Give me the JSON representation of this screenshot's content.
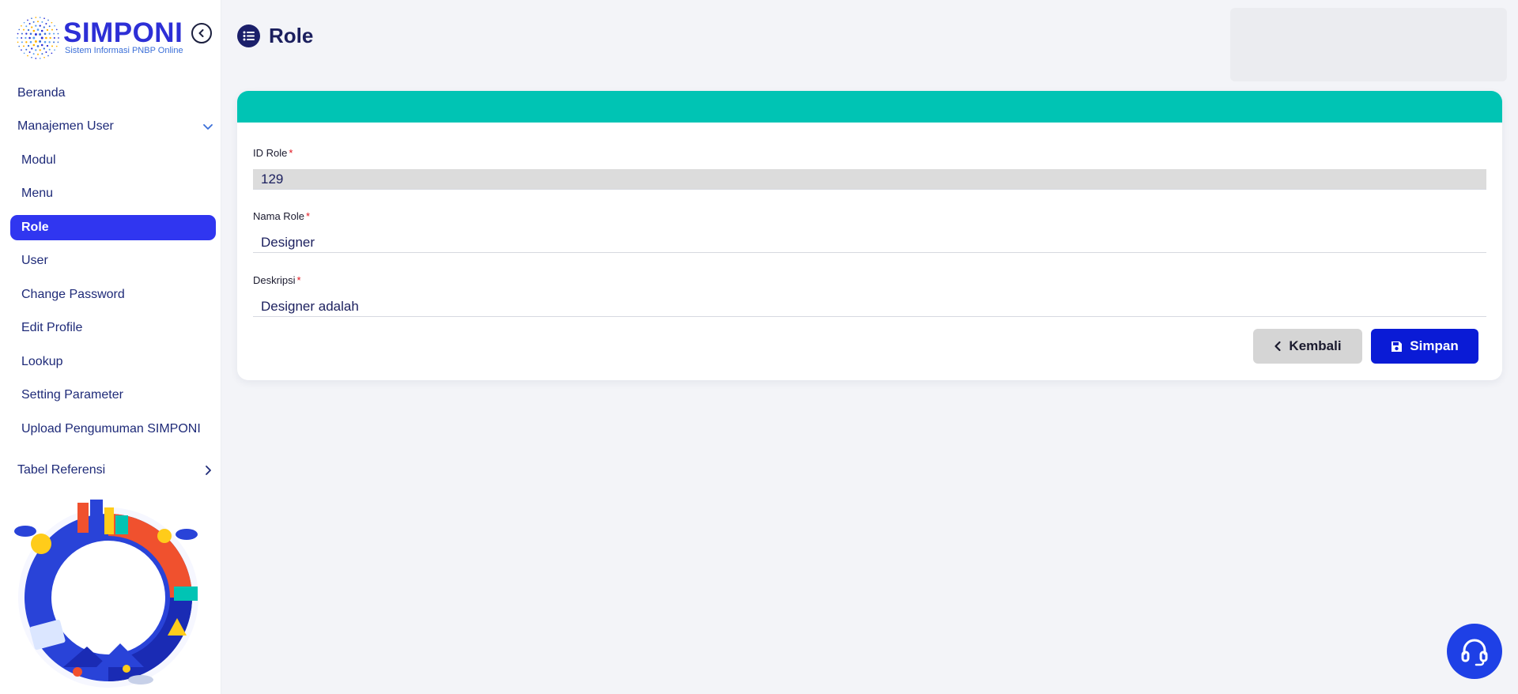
{
  "app": {
    "name": "SIMPONI",
    "subtitle": "Sistem Informasi PNBP Online"
  },
  "sidebar": {
    "items": [
      {
        "label": "Beranda"
      },
      {
        "label": "Manajemen User"
      },
      {
        "label": "Modul"
      },
      {
        "label": "Menu"
      },
      {
        "label": "Role"
      },
      {
        "label": "User"
      },
      {
        "label": "Change Password"
      },
      {
        "label": "Edit Profile"
      },
      {
        "label": "Lookup"
      },
      {
        "label": "Setting Parameter"
      },
      {
        "label": "Upload Pengumuman SIMPONI"
      },
      {
        "label": "Tabel Referensi"
      }
    ]
  },
  "page": {
    "title": "Role"
  },
  "form": {
    "required_marker": "*",
    "fields": [
      {
        "label": "ID Role",
        "value": "129"
      },
      {
        "label": "Nama Role",
        "value": "Designer"
      },
      {
        "label": "Deskripsi",
        "value": "Designer adalah"
      }
    ],
    "buttons": {
      "back": "Kembali",
      "save": "Simpan"
    }
  },
  "colors": {
    "accent": "#3036f0",
    "card_header": "#00c4b4",
    "primary_button": "#0a1bd6",
    "secondary_button": "#d5d5d5",
    "required": "#e0141e",
    "help_button": "#1e40e6"
  },
  "icons": {
    "collapse": "chevron-left-circle-icon",
    "title": "list-icon",
    "back": "chevron-left-icon",
    "save": "floppy-disk-icon",
    "help": "headset-icon",
    "expanded": "chevron-down-icon",
    "collapsed": "chevron-right-icon"
  }
}
